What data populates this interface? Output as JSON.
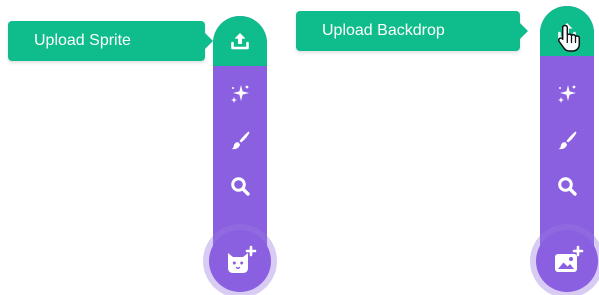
{
  "colors": {
    "green_accent": "#0fbd8c",
    "purple_menu": "#8a5fe0",
    "purple_ring": "#9b78e1",
    "icon_white": "#ffffff"
  },
  "sprite_menu": {
    "tooltip": "Upload Sprite",
    "icons": [
      "upload-icon",
      "surprise-sparkle-icon",
      "paint-brush-icon",
      "search-icon"
    ],
    "main_button_icon": "add-sprite-cat-icon"
  },
  "backdrop_menu": {
    "tooltip": "Upload Backdrop",
    "icons": [
      "upload-icon",
      "surprise-sparkle-icon",
      "paint-brush-icon",
      "search-icon"
    ],
    "main_button_icon": "add-backdrop-image-icon",
    "cursor_icon": "hand-pointer-cursor-icon"
  }
}
